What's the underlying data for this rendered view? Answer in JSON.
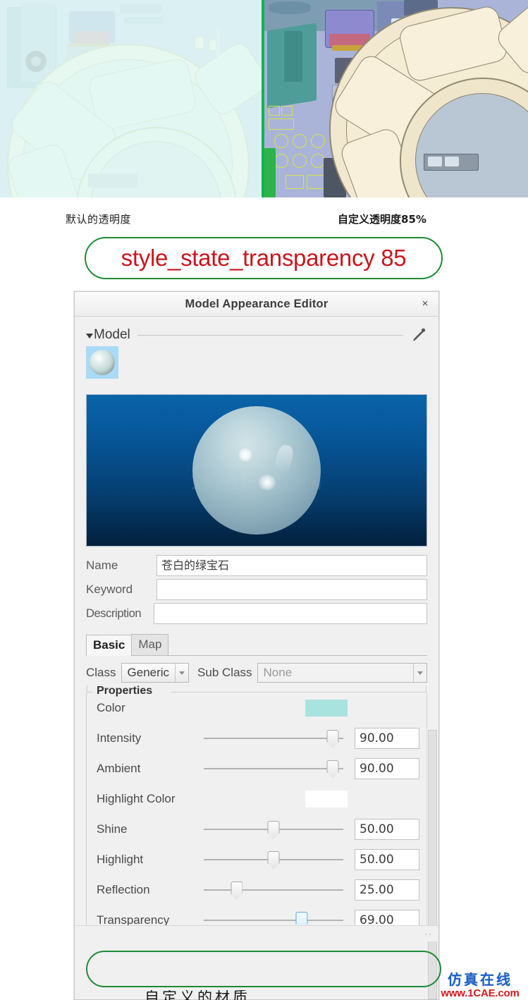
{
  "comparison": {
    "left_caption": "默认的透明度",
    "right_caption": "自定义透明度85%",
    "left_pane_name": "default-transparency-viewport",
    "right_pane_name": "custom-transparency-viewport"
  },
  "callout": {
    "text": "style_state_transparency 85",
    "text_color": "#c8161d",
    "border_color": "#1f8b34"
  },
  "dialog": {
    "title": "Model Appearance Editor",
    "close_label": "×",
    "group": {
      "label": "Model",
      "expander": "▾",
      "eyedropper_name": "eyedropper-icon"
    },
    "preview": {
      "watermark": "1CAE.COM"
    },
    "fields": [
      {
        "label": "Name",
        "value": "苍白的绿宝石",
        "placeholder": ""
      },
      {
        "label": "Keyword",
        "value": "",
        "placeholder": ""
      },
      {
        "label": "Description",
        "value": "",
        "placeholder": ""
      }
    ],
    "tabs": [
      {
        "label": "Basic",
        "active": true
      },
      {
        "label": "Map",
        "active": false
      }
    ],
    "class_row": {
      "class_label": "Class",
      "class_value": "Generic",
      "sub_class_label": "Sub Class",
      "sub_class_value": "None"
    },
    "properties": {
      "legend": "Properties",
      "rows": [
        {
          "label": "Color",
          "kind": "color",
          "swatch": "#a9e3e0",
          "value": ""
        },
        {
          "label": "Intensity",
          "kind": "slider",
          "value": "90.00",
          "pct": 90
        },
        {
          "label": "Ambient",
          "kind": "slider",
          "value": "90.00",
          "pct": 90
        },
        {
          "label": "Highlight Color",
          "kind": "color",
          "swatch": "#ffffff",
          "value": ""
        },
        {
          "label": "Shine",
          "kind": "slider",
          "value": "50.00",
          "pct": 50
        },
        {
          "label": "Highlight",
          "kind": "slider",
          "value": "50.00",
          "pct": 50
        },
        {
          "label": "Reflection",
          "kind": "slider",
          "value": "25.00",
          "pct": 25
        },
        {
          "label": "Transparency",
          "kind": "slider",
          "value": "69.00",
          "pct": 69,
          "highlighted": true
        }
      ]
    }
  },
  "bottom_cut_text": "自定义的材质",
  "watermark": {
    "cn": "仿真在线",
    "url": "www.1CAE.com",
    "cn_color": "#1f5fc4",
    "url_color": "#d01a1a"
  }
}
